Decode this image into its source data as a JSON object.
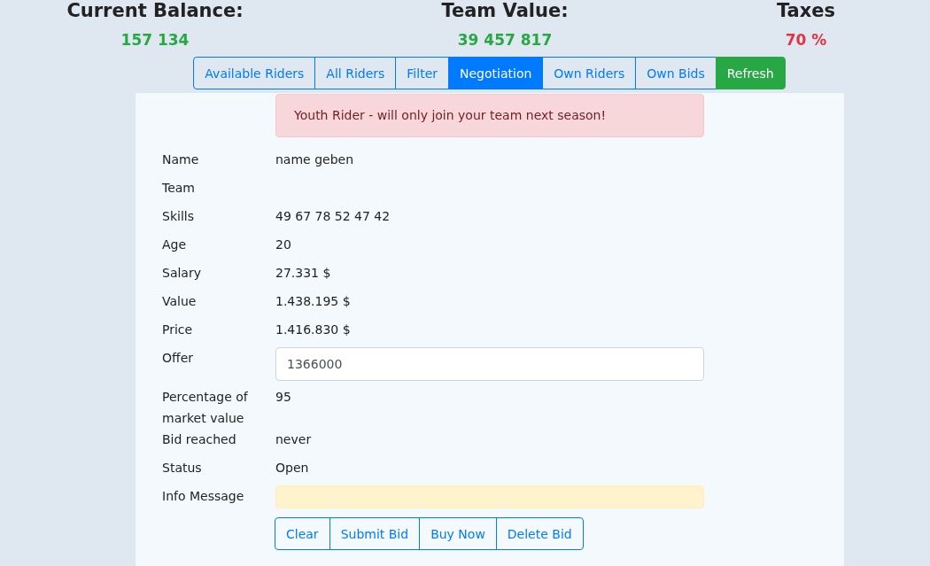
{
  "summary": [
    {
      "label": "Current Balance:",
      "value": "157 134",
      "color": "#28a745"
    },
    {
      "label": "Team Value:",
      "value": "39 457 817",
      "color": "#28a745"
    },
    {
      "label": "Taxes",
      "value": "70 %",
      "color": "#dc3545"
    }
  ],
  "tabs": [
    {
      "label": "Available Riders",
      "kind": "tab",
      "selected": false
    },
    {
      "label": "All Riders",
      "kind": "tab",
      "selected": false
    },
    {
      "label": "Filter",
      "kind": "tab",
      "selected": false
    },
    {
      "label": "Negotiation",
      "kind": "tab",
      "selected": true
    },
    {
      "label": "Own Riders",
      "kind": "tab",
      "selected": false
    },
    {
      "label": "Own Bids",
      "kind": "tab",
      "selected": false
    },
    {
      "label": "Refresh",
      "kind": "action"
    }
  ],
  "alert": "Youth Rider - will only join your team next season!",
  "fields": [
    {
      "label": "Name",
      "kind": "text",
      "value": "name geben"
    },
    {
      "label": "Team",
      "kind": "text"
    },
    {
      "label": "Skills",
      "kind": "text",
      "value": "49 67 78 52 47 42"
    },
    {
      "label": "Age",
      "kind": "text",
      "value": "20"
    },
    {
      "label": "Salary",
      "kind": "text",
      "value": "27.331 $"
    },
    {
      "label": "Value",
      "kind": "text",
      "value": "1.438.195 $"
    },
    {
      "label": "Price",
      "kind": "text",
      "value": "1.416.830 $"
    },
    {
      "label": "Offer",
      "kind": "input",
      "value": "1366000"
    },
    {
      "label": "Percentage of market value",
      "kind": "text",
      "value": "95"
    },
    {
      "label": "Bid reached",
      "kind": "text",
      "value": "never"
    },
    {
      "label": "Status",
      "kind": "text",
      "value": "Open"
    },
    {
      "label": "Info Message",
      "kind": "message"
    }
  ],
  "buttons": [
    "Clear",
    "Submit Bid",
    "Buy Now",
    "Delete Bid"
  ]
}
